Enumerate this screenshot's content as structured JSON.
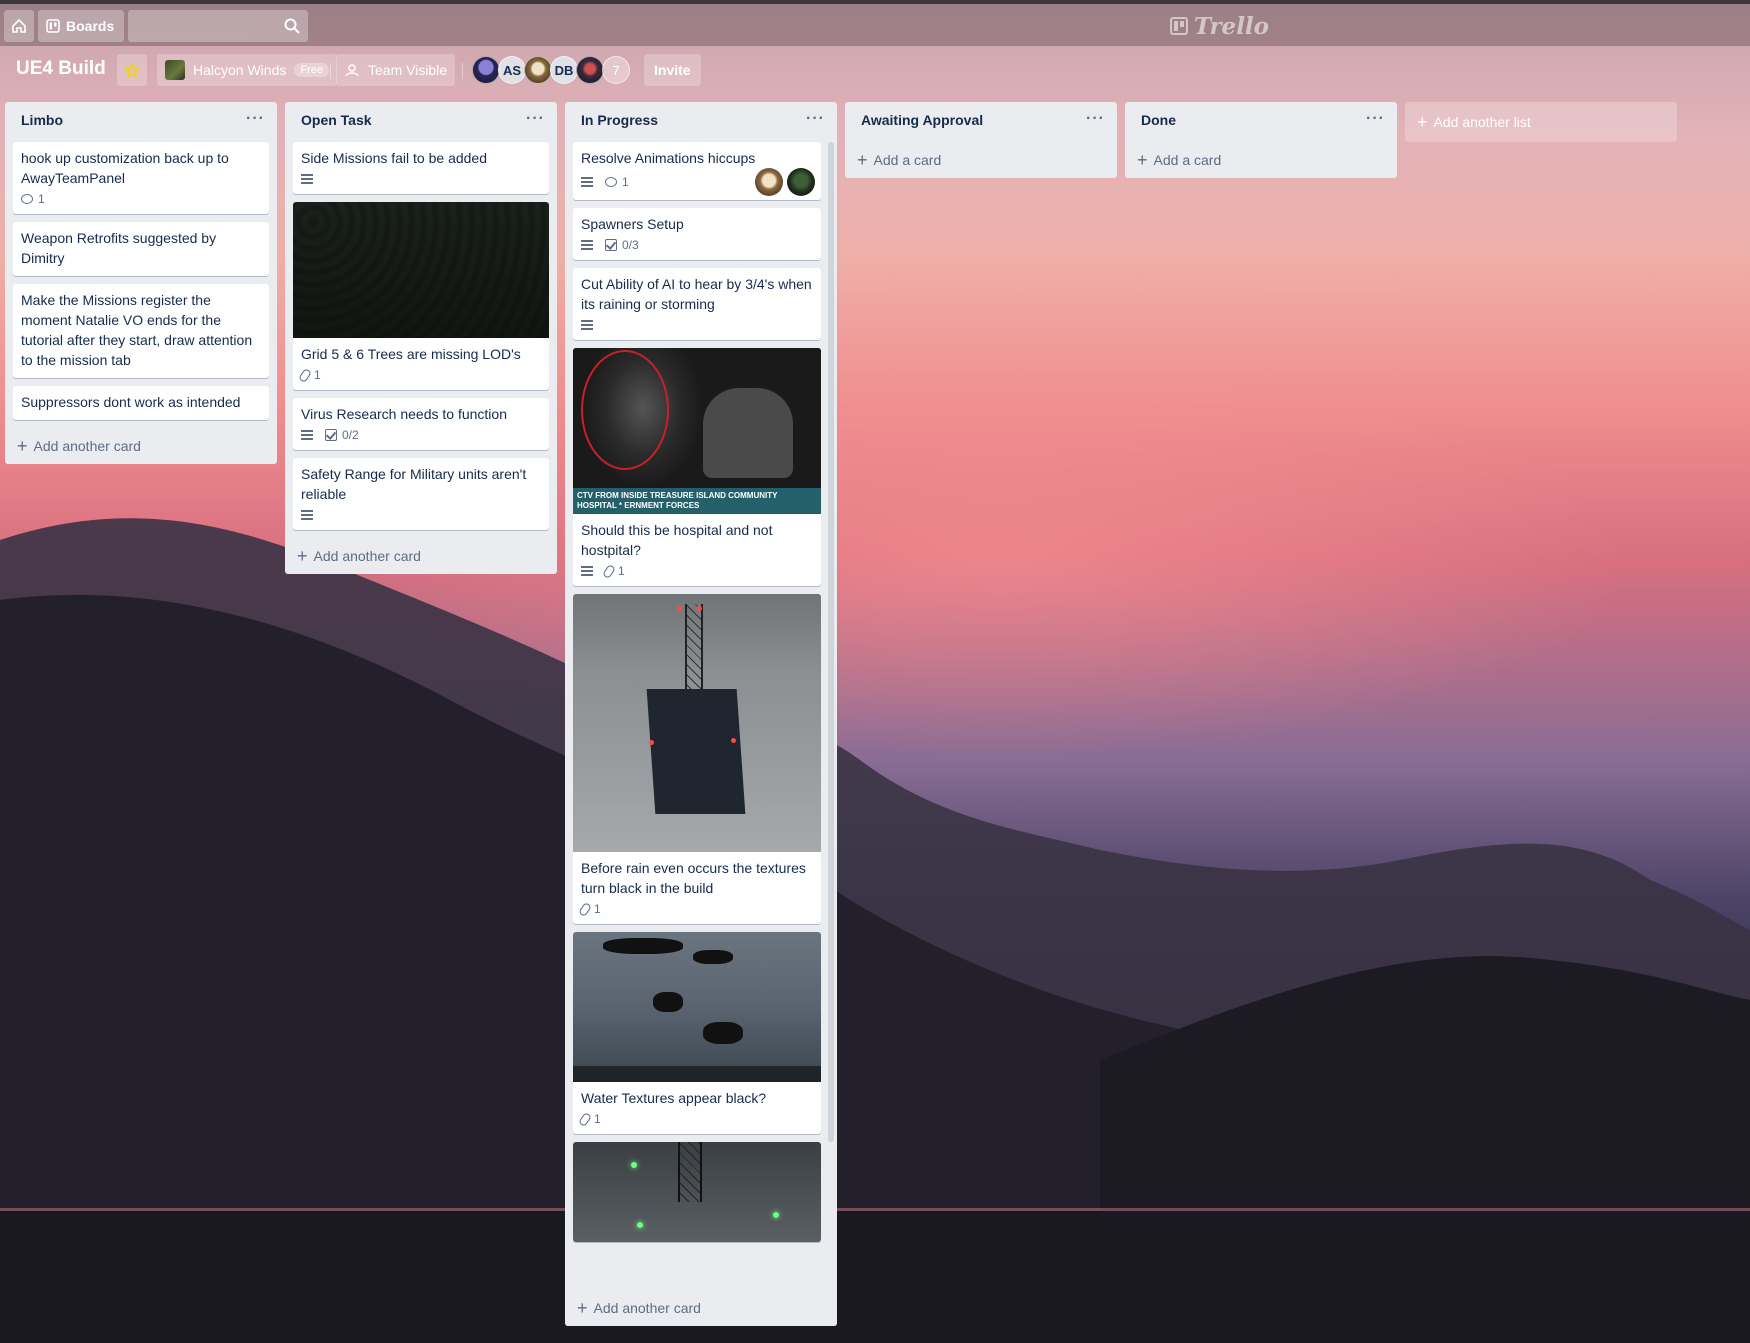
{
  "header": {
    "boards_label": "Boards",
    "search_placeholder": "",
    "brand": "Trello"
  },
  "board": {
    "title": "UE4 Build",
    "workspace": "Halcyon Winds",
    "workspace_badge": "Free",
    "visibility": "Team Visible",
    "members": [
      "AS",
      "DB"
    ],
    "member_count": "7",
    "invite_label": "Invite"
  },
  "lists": {
    "limbo": {
      "title": "Limbo",
      "cards": [
        {
          "title": "hook up customization back up to AwayTeamPanel",
          "comments": "1"
        },
        {
          "title": "Weapon Retrofits suggested by Dimitry"
        },
        {
          "title": "Make the Missions register the moment Natalie VO ends for the tutorial after they start, draw attention to the mission tab"
        },
        {
          "title": "Suppressors dont work as intended"
        }
      ],
      "add_label": "Add another card"
    },
    "open": {
      "title": "Open Task",
      "cards": [
        {
          "title": "Side Missions fail to be added"
        },
        {
          "title": "Grid 5 & 6 Trees are missing LOD's",
          "attachments": "1"
        },
        {
          "title": "Virus Research needs to function",
          "checklist": "0/2"
        },
        {
          "title": "Safety Range for Military units aren't reliable"
        }
      ],
      "add_label": "Add another card"
    },
    "progress": {
      "title": "In Progress",
      "cards": [
        {
          "title": "Resolve Animations hiccups",
          "comments": "1"
        },
        {
          "title": "Spawners Setup",
          "checklist": "0/3"
        },
        {
          "title": "Cut Ability of AI to hear by 3/4's when its raining or storming"
        },
        {
          "title": "Should this be hospital and not hostpital?",
          "attachments": "1",
          "cover_caption": "CTV FROM INSIDE TREASURE ISLAND COMMUNITY HOSPITAL * ERNMENT FORCES"
        },
        {
          "title": "Before rain even occurs the textures turn black in the build",
          "attachments": "1"
        },
        {
          "title": "Water Textures appear black?",
          "attachments": "1"
        }
      ],
      "add_label": "Add another card"
    },
    "awaiting": {
      "title": "Awaiting Approval",
      "add_label": "Add a card"
    },
    "done": {
      "title": "Done",
      "add_label": "Add a card"
    }
  },
  "add_list_label": "Add another list",
  "colors": {
    "list_bg": "#ebecf0",
    "card_bg": "#ffffff",
    "text": "#172b4d",
    "muted": "#5e6c84",
    "star": "#f2d600"
  }
}
